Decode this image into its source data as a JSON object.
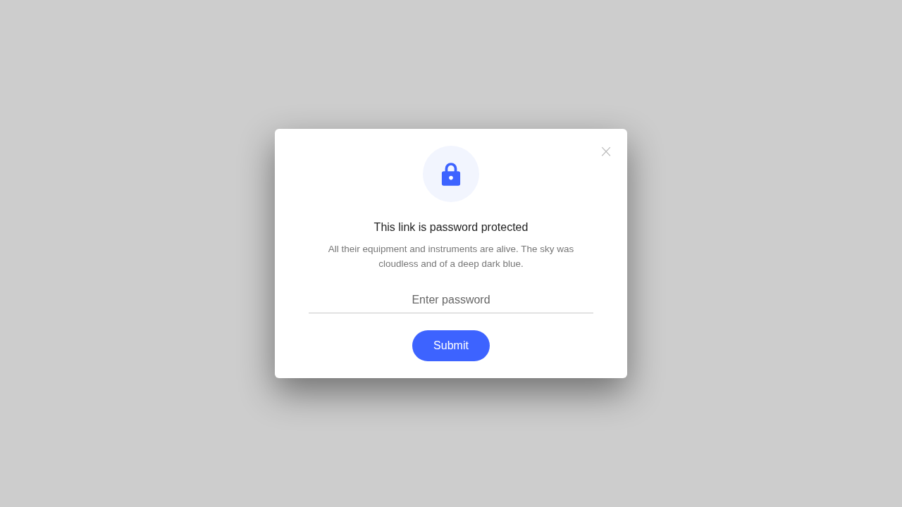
{
  "dialog": {
    "title": "This link is password protected",
    "description": "All their equipment and instruments are alive. The sky was cloudless and of a deep dark blue.",
    "password_field": {
      "placeholder": "Enter password"
    },
    "submit_button": "Submit",
    "close_button": "×"
  }
}
